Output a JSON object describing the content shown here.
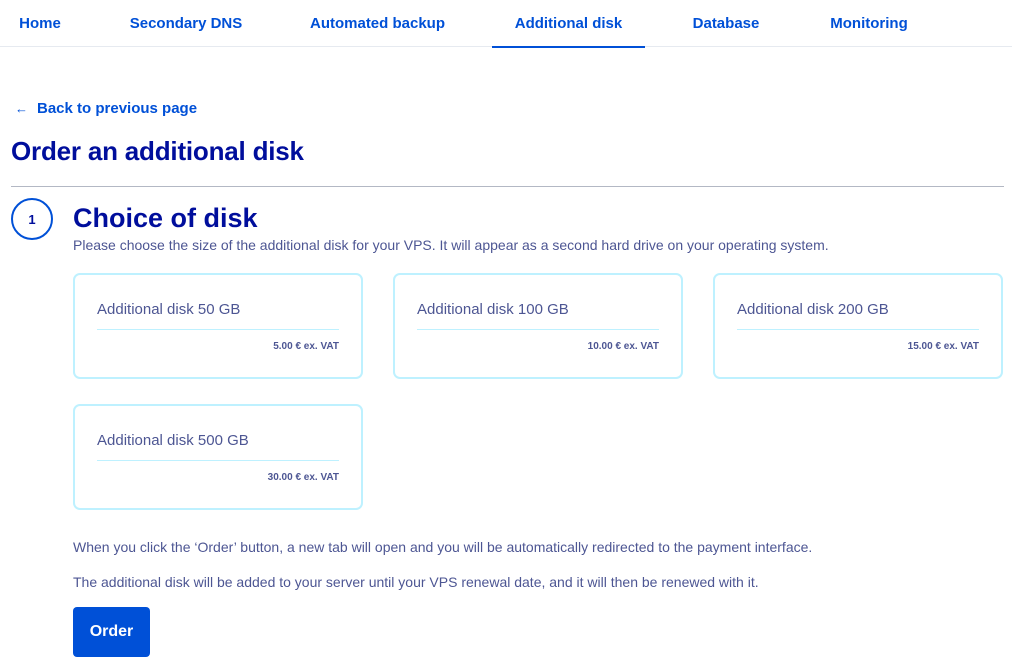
{
  "tabs": [
    {
      "label": "Home"
    },
    {
      "label": "Secondary DNS"
    },
    {
      "label": "Automated backup"
    },
    {
      "label": "Additional disk",
      "active": true
    },
    {
      "label": "Database"
    },
    {
      "label": "Monitoring"
    }
  ],
  "back_link": {
    "icon": "arrow-left-icon",
    "arrow": "←",
    "label": "Back to previous page"
  },
  "page_title": "Order an additional disk",
  "step": {
    "number": "1",
    "title": "Choice of disk",
    "description": "Please choose the size of the additional disk for your VPS. It will appear as a second hard drive on your operating system."
  },
  "disks": [
    {
      "name": "Additional disk 50 GB",
      "price": "5.00 € ex. VAT"
    },
    {
      "name": "Additional disk 100 GB",
      "price": "10.00 € ex. VAT"
    },
    {
      "name": "Additional disk 200 GB",
      "price": "15.00 € ex. VAT"
    },
    {
      "name": "Additional disk 500 GB",
      "price": "30.00 € ex. VAT"
    }
  ],
  "info": [
    "When you click the ‘Order’ button, a new tab will open and you will be automatically redirected to the payment interface.",
    "The additional disk will be added to your server until your VPS renewal date, and it will then be renewed with it."
  ],
  "order_button": "Order",
  "colors": {
    "accent": "#0050d7",
    "title": "#000e9c",
    "text": "#4d5693",
    "card_border": "#bef1ff"
  }
}
